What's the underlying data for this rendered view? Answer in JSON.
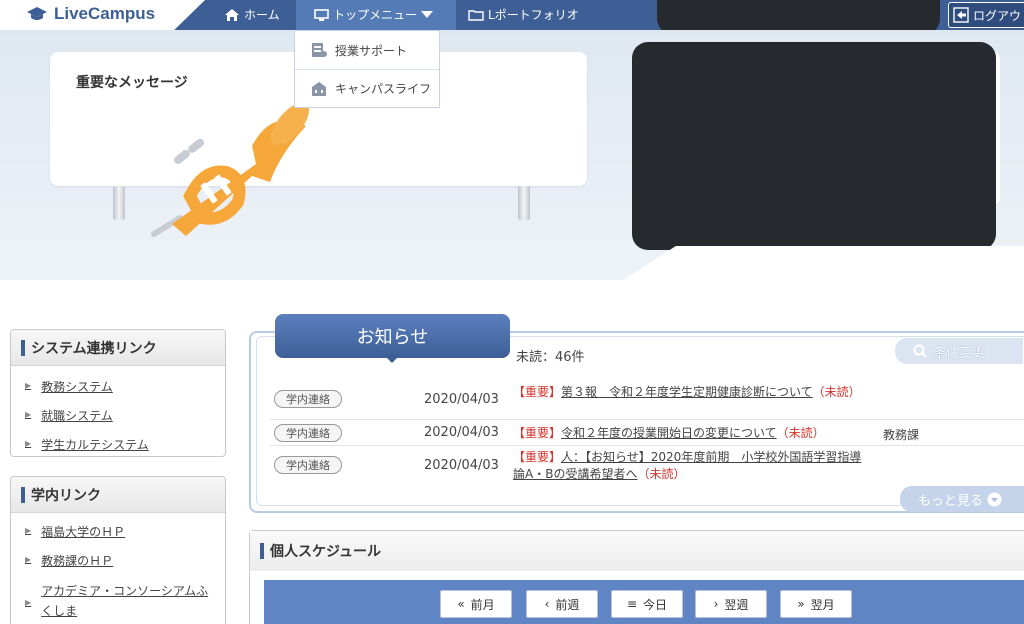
{
  "app": {
    "name": "LiveCampus"
  },
  "nav": {
    "home": "ホーム",
    "top_menu": "トップメニュー",
    "portfolio": "Lポートフォリオ",
    "logout": "ログアウ"
  },
  "dropdown": {
    "items": [
      {
        "label": "授業サポート"
      },
      {
        "label": "キャンパスライフ"
      }
    ]
  },
  "hero": {
    "message_title": "重要なメッセージ"
  },
  "sidebar": {
    "system_links": {
      "title": "システム連携リンク",
      "items": [
        {
          "label": "教務システム"
        },
        {
          "label": "就職システム"
        },
        {
          "label": "学生カルテシステム"
        }
      ]
    },
    "campus_links": {
      "title": "学内リンク",
      "items": [
        {
          "label": "福島大学のＨＰ"
        },
        {
          "label": "教務課のＨＰ"
        },
        {
          "label": "アカデミア・コンソーシアムふくしま"
        }
      ]
    }
  },
  "notices": {
    "tab_label": "お知らせ",
    "unread": "未読：46件",
    "filter_button": "条件変更",
    "more_button": "もっと見る",
    "rows": [
      {
        "tag": "学内連絡",
        "date": "2020/04/03",
        "important": "【重要】",
        "title": "第３報　令和２年度学生定期健康診断について",
        "status": "（未読）",
        "dept": ""
      },
      {
        "tag": "学内連絡",
        "date": "2020/04/03",
        "important": "【重要】",
        "title": "令和２年度の授業開始日の変更について",
        "status": "（未読）",
        "dept": "教務課"
      },
      {
        "tag": "学内連絡",
        "date": "2020/04/03",
        "important": "【重要】",
        "title": "人：【お知らせ】2020年度前期　小学校外国語学習指導論A・Bの受講希望者へ",
        "status": "（未読）",
        "dept": ""
      }
    ]
  },
  "schedule": {
    "title": "個人スケジュール",
    "buttons": {
      "prev_month": "前月",
      "prev_week": "前週",
      "today": "今日",
      "next_week": "翌週",
      "next_month": "翌月"
    }
  },
  "colors": {
    "brand": "#3e5f96",
    "accent": "#557bb6",
    "alert": "#d7332d",
    "trumpet": "#f5a73a"
  }
}
